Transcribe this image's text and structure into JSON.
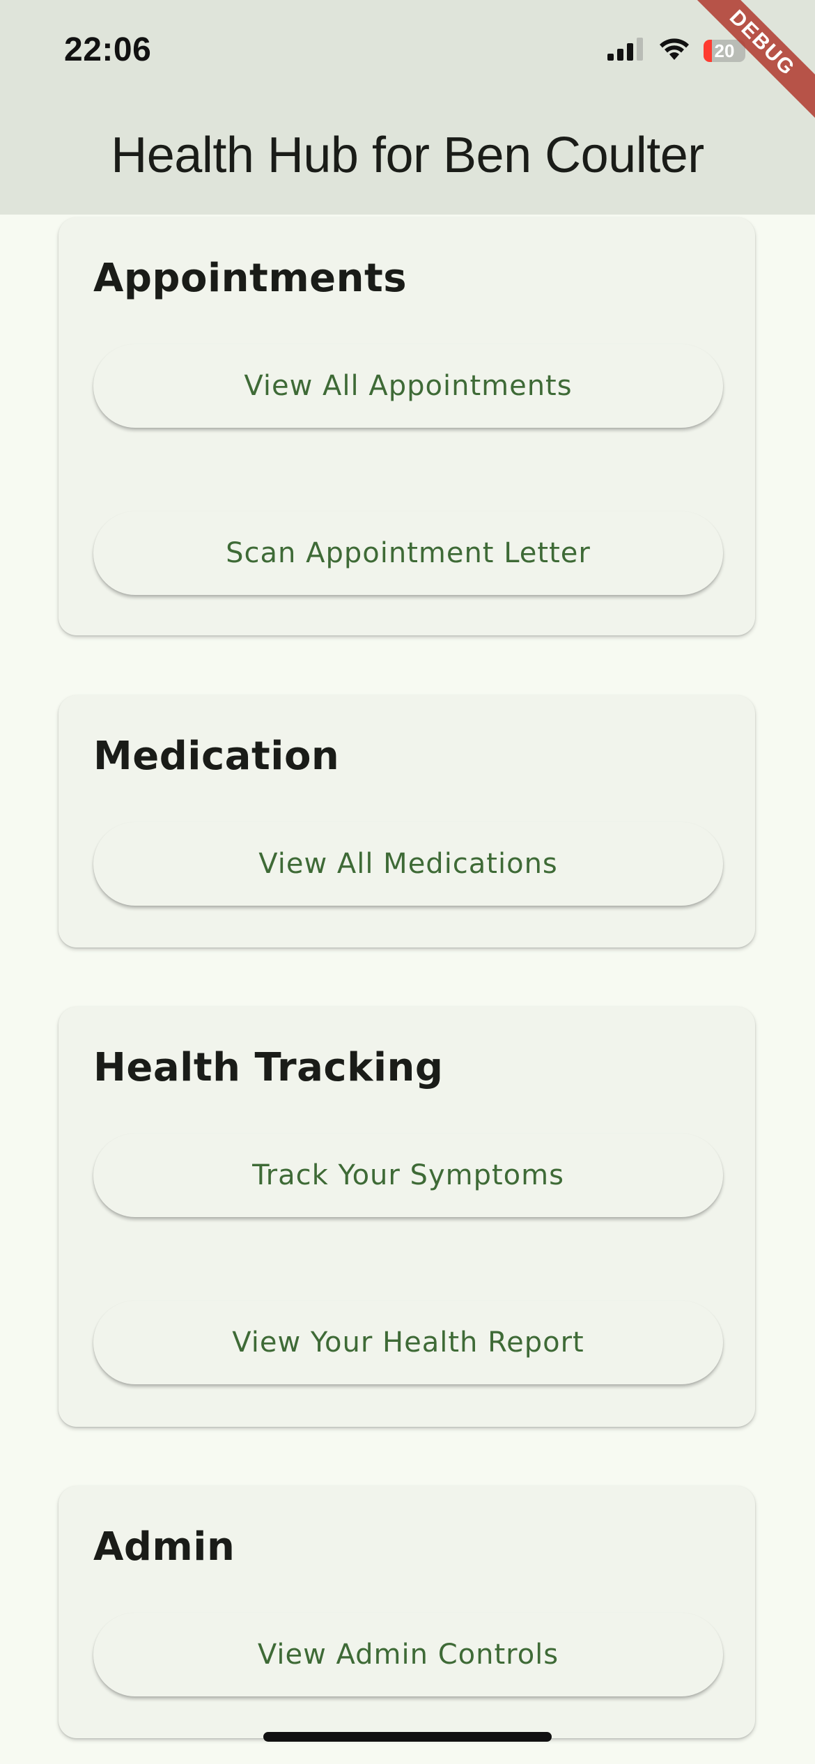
{
  "status_bar": {
    "time": "22:06",
    "battery_level": "20",
    "battery_fraction": 0.2,
    "icons": [
      "cellular-signal-icon",
      "wifi-icon",
      "battery-icon"
    ]
  },
  "app_bar": {
    "title": "Health Hub for Ben Coulter"
  },
  "debug_banner": {
    "text": "DEBUG"
  },
  "sections": {
    "appointments": {
      "title": "Appointments",
      "buttons": {
        "view_all": "View All Appointments",
        "scan_letter": "Scan Appointment Letter"
      }
    },
    "medication": {
      "title": "Medication",
      "buttons": {
        "view_all": "View All Medications"
      }
    },
    "health_tracking": {
      "title": "Health Tracking",
      "buttons": {
        "track_symptoms": "Track Your Symptoms",
        "health_report": "View Your Health Report"
      }
    },
    "admin": {
      "title": "Admin",
      "buttons": {
        "admin_controls": "View Admin Controls"
      }
    }
  },
  "colors": {
    "app_bar_bg": "#dfe4da",
    "page_bg": "#f7faf2",
    "card_bg": "#f1f4ec",
    "button_text": "#3e6a36",
    "title_text": "#1a1c18",
    "debug_banner": "#b03a2e",
    "battery_low": "#ff3b30"
  }
}
